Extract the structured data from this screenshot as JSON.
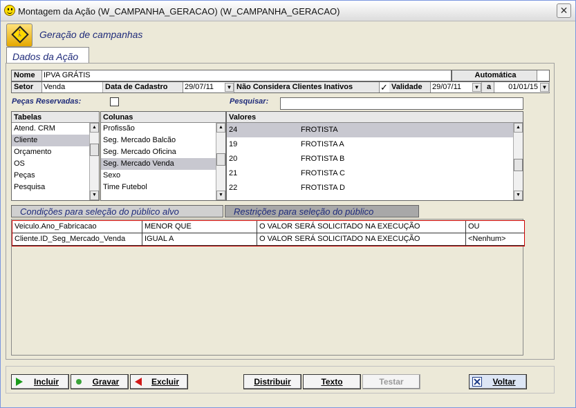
{
  "window": {
    "title": "Montagem da Ação (W_CAMPANHA_GERACAO) (W_CAMPANHA_GERACAO)",
    "close": "✕"
  },
  "header": {
    "title": "Geração de campanhas"
  },
  "tab": {
    "label": "Dados da Ação"
  },
  "form": {
    "nome_label": "Nome",
    "nome_value": "IPVA GRÁTIS",
    "automatica_label": "Automática",
    "setor_label": "Setor",
    "setor_value": "Venda",
    "data_cadastro_label": "Data de Cadastro",
    "data_cadastro_value": "29/07/11",
    "nao_considera_label": "Não Considera Clientes Inativos",
    "nao_considera_checked": "✓",
    "validade_label": "Validade",
    "validade_from": "29/07/11",
    "validade_sep": "a",
    "validade_to": "01/01/15"
  },
  "pecas_label": "Peças Reservadas:",
  "pesquisar_label": "Pesquisar:",
  "tabelas": {
    "header": "Tabelas",
    "items": [
      "Atend. CRM",
      "Cliente",
      "Orçamento",
      "OS",
      "Peças",
      "Pesquisa"
    ],
    "selected": 1
  },
  "colunas": {
    "header": "Colunas",
    "items": [
      "Profissão",
      "Seg. Mercado Balcão",
      "Seg. Mercado Oficina",
      "Seg. Mercado Venda",
      "Sexo",
      "Time Futebol"
    ],
    "selected": 3
  },
  "valores": {
    "header": "Valores",
    "items": [
      {
        "code": "24",
        "desc": "FROTISTA"
      },
      {
        "code": "19",
        "desc": "FROTISTA A"
      },
      {
        "code": "20",
        "desc": "FROTISTA B"
      },
      {
        "code": "21",
        "desc": "FROTISTA C"
      },
      {
        "code": "22",
        "desc": "FROTISTA D"
      }
    ],
    "selected": 0
  },
  "subtabs": {
    "condicoes": "Condições para seleção do público alvo",
    "restricoes": "Restrições para seleção do público"
  },
  "grid": {
    "rows": [
      [
        "Veiculo.Ano_Fabricacao",
        "MENOR QUE",
        "O VALOR SERÁ SOLICITADO NA EXECUÇÃO",
        "OU"
      ],
      [
        "Cliente.ID_Seg_Mercado_Venda",
        "IGUAL A",
        "O VALOR SERÁ SOLICITADO NA EXECUÇÃO",
        "<Nenhum>"
      ]
    ]
  },
  "buttons": {
    "incluir": "Incluir",
    "gravar": "Gravar",
    "excluir": "Excluir",
    "distribuir": "Distribuir",
    "texto": "Texto",
    "testar": "Testar",
    "voltar": "Voltar"
  }
}
